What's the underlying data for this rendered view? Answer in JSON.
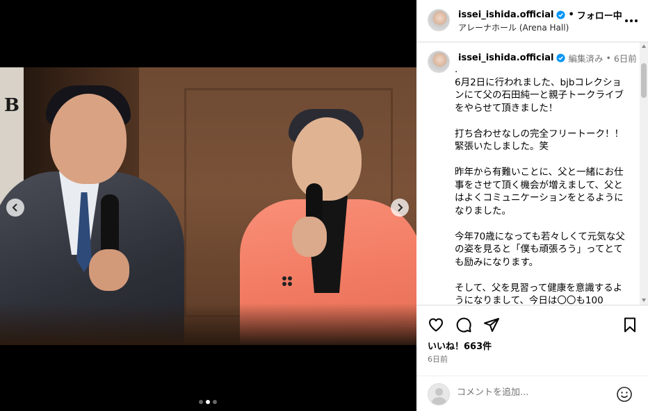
{
  "post": {
    "username": "issei_ishida.official",
    "follow_status": "フォロー中",
    "separator": "•",
    "location": "アレーナホール (Arena Hall)",
    "media_slide_index": 2,
    "media_slide_count": 3
  },
  "caption": {
    "username": "issei_ishida.official",
    "edited_label": "編集済み",
    "dot": "•",
    "time_ago": "6日前",
    "text": ".\n6月2日に行われました、bjbコレクションにて父の石田純一と親子トークライブをやらせて頂きました！\n\n打ち合わせなしの完全フリートーク！！\n緊張いたしました。笑\n\n昨年から有難いことに、父と一緒にお仕事をさせて頂く機会が増えまして、父とはよくコミュニケーションをとるようになりました。\n\n今年70歳になっても若々しくて元気な父の姿を見ると「僕も頑張ろう」ってとても励みになります。\n\nそして、父を見習って健康を意識するようになりまして、今日は〇〇も100"
  },
  "engagement": {
    "likes_label": "いいね！663件",
    "timestamp": "6日前"
  },
  "comment_box": {
    "placeholder": "コメントを追加..."
  },
  "icons": {
    "verified": "verified-badge-icon",
    "like": "heart-icon",
    "comment": "comment-bubble-icon",
    "share": "paper-plane-icon",
    "save": "bookmark-icon",
    "emoji": "smiley-icon",
    "more": "more-dots-icon",
    "prev": "chevron-left-icon",
    "next": "chevron-right-icon"
  },
  "colors": {
    "verified_blue": "#0095f6",
    "text_primary": "#000000",
    "text_secondary": "#737373",
    "border": "#dbdbdb"
  }
}
